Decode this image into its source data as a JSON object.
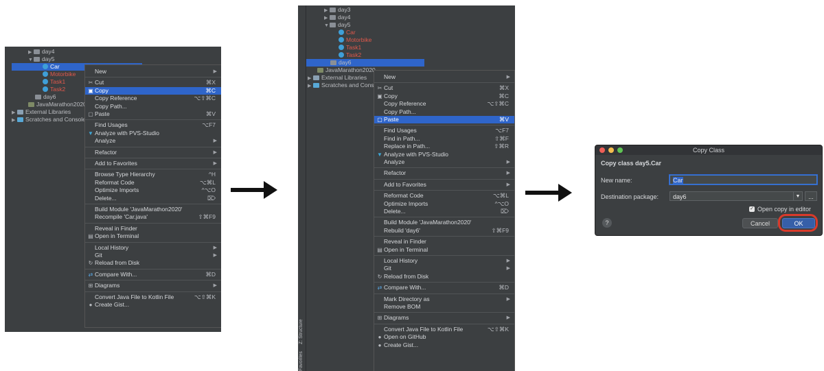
{
  "panel1": {
    "tree": [
      {
        "label": "day4",
        "type": "folder",
        "collapsed": true
      },
      {
        "label": "day5",
        "type": "folder",
        "collapsed": false
      },
      {
        "label": "Car",
        "type": "class",
        "selected": true
      },
      {
        "label": "Motorbike",
        "type": "class",
        "red": true
      },
      {
        "label": "Task1",
        "type": "class",
        "red": true
      },
      {
        "label": "Task2",
        "type": "class",
        "red": true
      },
      {
        "label": "day6",
        "type": "folder"
      },
      {
        "label": "JavaMarathon2020",
        "type": "module"
      },
      {
        "label": "External Libraries",
        "type": "lib"
      },
      {
        "label": "Scratches and Consoles",
        "type": "scratch"
      }
    ],
    "menu": [
      {
        "label": "New",
        "sub": true
      },
      {
        "sep": true
      },
      {
        "label": "Cut",
        "icon": "cut-icon",
        "glyph": "✂",
        "shortcut": "⌘X"
      },
      {
        "label": "Copy",
        "icon": "copy-icon",
        "glyph": "▣",
        "shortcut": "⌘C",
        "highlight": true
      },
      {
        "label": "Copy Reference",
        "shortcut": "⌥⇧⌘C"
      },
      {
        "label": "Copy Path..."
      },
      {
        "label": "Paste",
        "icon": "paste-icon",
        "glyph": "▢",
        "shortcut": "⌘V"
      },
      {
        "sep": true
      },
      {
        "label": "Find Usages",
        "shortcut": "⌥F7"
      },
      {
        "label": "Analyze with PVS-Studio",
        "icon": "pvs-icon",
        "glyph": "▼"
      },
      {
        "label": "Analyze",
        "sub": true
      },
      {
        "sep": true
      },
      {
        "label": "Refactor",
        "sub": true
      },
      {
        "sep": true
      },
      {
        "label": "Add to Favorites",
        "sub": true
      },
      {
        "sep": true
      },
      {
        "label": "Browse Type Hierarchy",
        "shortcut": "^H"
      },
      {
        "label": "Reformat Code",
        "shortcut": "⌥⌘L"
      },
      {
        "label": "Optimize Imports",
        "shortcut": "^⌥O"
      },
      {
        "label": "Delete...",
        "shortcut": "⌦"
      },
      {
        "sep": true
      },
      {
        "label": "Build Module 'JavaMarathon2020'"
      },
      {
        "label": "Recompile 'Car.java'",
        "shortcut": "⇧⌘F9"
      },
      {
        "sep": true
      },
      {
        "label": "Reveal in Finder"
      },
      {
        "label": "Open in Terminal",
        "icon": "terminal-icon",
        "glyph": "▤"
      },
      {
        "sep": true
      },
      {
        "label": "Local History",
        "sub": true
      },
      {
        "label": "Git",
        "sub": true
      },
      {
        "label": "Reload from Disk",
        "icon": "reload-icon",
        "glyph": "↻"
      },
      {
        "sep": true
      },
      {
        "label": "Compare With...",
        "icon": "compare-icon",
        "glyph": "⇄",
        "shortcut": "⌘D"
      },
      {
        "sep": true
      },
      {
        "label": "Diagrams",
        "icon": "diagrams-icon",
        "glyph": "⊞",
        "sub": true
      },
      {
        "sep": true
      },
      {
        "label": "Convert Java File to Kotlin File",
        "shortcut": "⌥⇧⌘K"
      },
      {
        "label": "Create Gist...",
        "icon": "github-icon",
        "glyph": "●"
      }
    ]
  },
  "panel2": {
    "tree": [
      {
        "label": "day3",
        "type": "folder",
        "collapsed": true
      },
      {
        "label": "day4",
        "type": "folder",
        "collapsed": true
      },
      {
        "label": "day5",
        "type": "folder",
        "collapsed": false
      },
      {
        "label": "Car",
        "type": "class",
        "red": true
      },
      {
        "label": "Motorbike",
        "type": "class",
        "red": true
      },
      {
        "label": "Task1",
        "type": "class",
        "red": true
      },
      {
        "label": "Task2",
        "type": "class",
        "red": true
      },
      {
        "label": "day6",
        "type": "folder",
        "selected": true
      },
      {
        "label": "JavaMarathon2020",
        "type": "module"
      },
      {
        "label": "External Libraries",
        "type": "lib"
      },
      {
        "label": "Scratches and Consoles",
        "type": "scratch"
      }
    ],
    "side_tabs": [
      "Z: Structure",
      "Favorites"
    ],
    "menu": [
      {
        "label": "New",
        "sub": true
      },
      {
        "sep": true
      },
      {
        "label": "Cut",
        "icon": "cut-icon",
        "glyph": "✂",
        "shortcut": "⌘X"
      },
      {
        "label": "Copy",
        "icon": "copy-icon",
        "glyph": "▣",
        "shortcut": "⌘C"
      },
      {
        "label": "Copy Reference",
        "shortcut": "⌥⇧⌘C"
      },
      {
        "label": "Copy Path..."
      },
      {
        "label": "Paste",
        "icon": "paste-icon",
        "glyph": "▢",
        "shortcut": "⌘V",
        "highlight": true
      },
      {
        "sep": true
      },
      {
        "label": "Find Usages",
        "shortcut": "⌥F7"
      },
      {
        "label": "Find in Path...",
        "shortcut": "⇧⌘F"
      },
      {
        "label": "Replace in Path...",
        "shortcut": "⇧⌘R"
      },
      {
        "label": "Analyze with PVS-Studio",
        "icon": "pvs-icon",
        "glyph": "▼"
      },
      {
        "label": "Analyze",
        "sub": true
      },
      {
        "sep": true
      },
      {
        "label": "Refactor",
        "sub": true
      },
      {
        "sep": true
      },
      {
        "label": "Add to Favorites",
        "sub": true
      },
      {
        "sep": true
      },
      {
        "label": "Reformat Code",
        "shortcut": "⌥⌘L"
      },
      {
        "label": "Optimize Imports",
        "shortcut": "^⌥O"
      },
      {
        "label": "Delete...",
        "shortcut": "⌦"
      },
      {
        "sep": true
      },
      {
        "label": "Build Module 'JavaMarathon2020'"
      },
      {
        "label": "Rebuild 'day6'",
        "shortcut": "⇧⌘F9"
      },
      {
        "sep": true
      },
      {
        "label": "Reveal in Finder"
      },
      {
        "label": "Open in Terminal",
        "icon": "terminal-icon",
        "glyph": "▤"
      },
      {
        "sep": true
      },
      {
        "label": "Local History",
        "sub": true
      },
      {
        "label": "Git",
        "sub": true
      },
      {
        "label": "Reload from Disk",
        "icon": "reload-icon",
        "glyph": "↻"
      },
      {
        "sep": true
      },
      {
        "label": "Compare With...",
        "icon": "compare-icon",
        "glyph": "⇄",
        "shortcut": "⌘D"
      },
      {
        "sep": true
      },
      {
        "label": "Mark Directory as",
        "sub": true
      },
      {
        "label": "Remove BOM"
      },
      {
        "sep": true
      },
      {
        "label": "Diagrams",
        "icon": "diagrams-icon",
        "glyph": "⊞",
        "sub": true
      },
      {
        "sep": true
      },
      {
        "label": "Convert Java File to Kotlin File",
        "shortcut": "⌥⇧⌘K"
      },
      {
        "label": "Open on GitHub",
        "icon": "github-icon",
        "glyph": "●"
      },
      {
        "label": "Create Gist...",
        "icon": "github-icon",
        "glyph": "●"
      }
    ]
  },
  "dialog": {
    "title": "Copy Class",
    "heading": "Copy class day5.Car",
    "new_name_label": "New name:",
    "new_name_value": "Car",
    "dest_label": "Destination package:",
    "dest_value": "day6",
    "open_copy_label": "Open copy in editor",
    "open_copy_checked": true,
    "help": "?",
    "cancel": "Cancel",
    "ok": "OK",
    "browse": "..."
  },
  "colors": {
    "selection": "#2f65ca",
    "unversioned_file": "#e0584b",
    "highlight_ring": "#d93a2b"
  }
}
